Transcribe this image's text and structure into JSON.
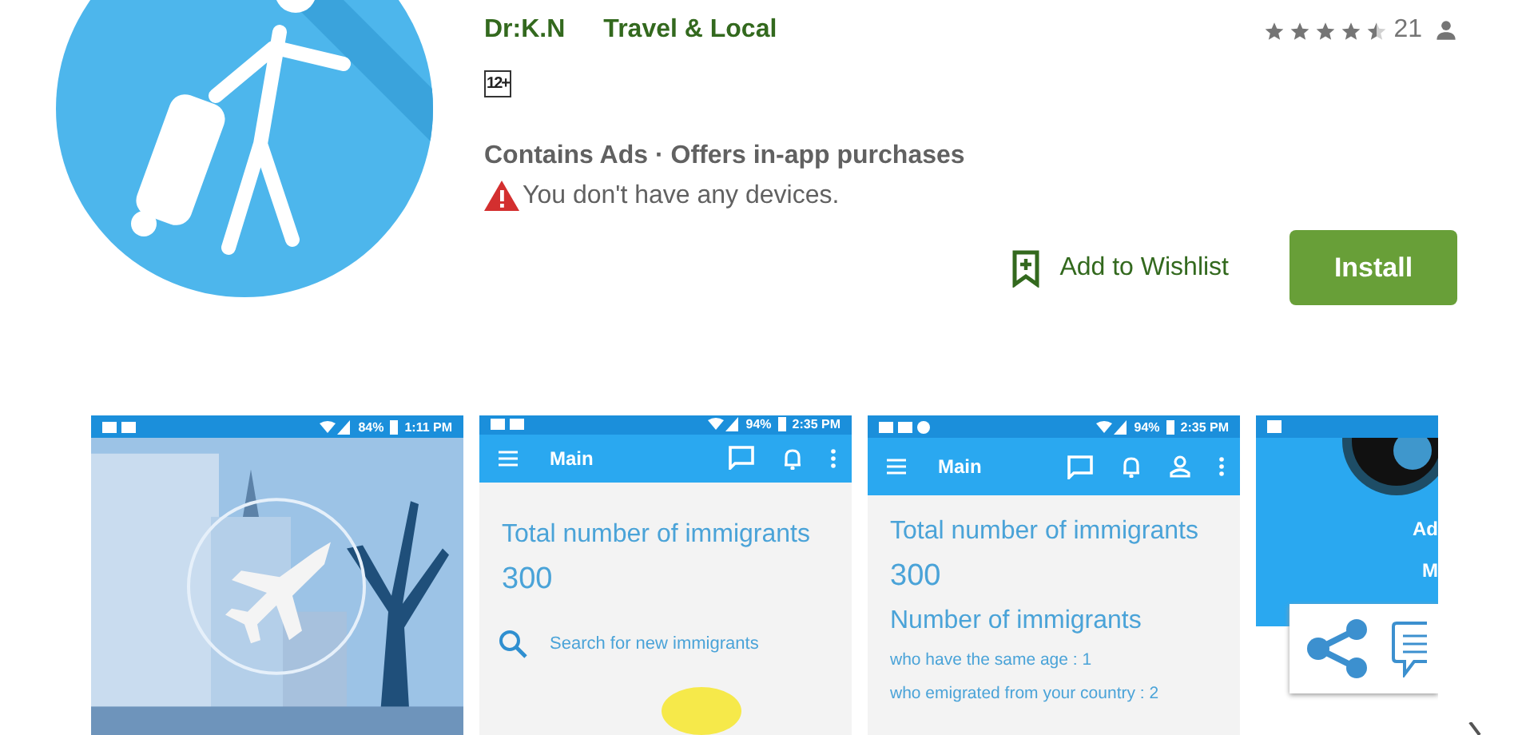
{
  "app": {
    "developer": "Dr:K.N",
    "category": "Travel & Local",
    "stars": 4.5,
    "rating_count": "21",
    "content_rating": "12+",
    "notes": "Contains Ads · Offers in-app purchases",
    "warning": "You don't have any devices.",
    "wishlist": "Add to Wishlist",
    "install": "Install"
  },
  "screenshots": [
    {
      "battery": "84%",
      "time": "1:11 PM"
    },
    {
      "kind": "stats",
      "battery": "94%",
      "time": "2:35 PM",
      "title": "Main",
      "heading": "Total number of immigrants",
      "count": "300",
      "search": "Search for new immigrants"
    },
    {
      "kind": "stats",
      "battery": "94%",
      "time": "2:35 PM",
      "title": "Main",
      "heading": "Total number of immigrants",
      "count": "300",
      "subheading": "Number of immigrants",
      "lines": [
        "who have the same age : 1",
        "who emigrated from your country : 2"
      ]
    },
    {
      "kind": "profile",
      "name": "Ad",
      "role": "M"
    }
  ]
}
